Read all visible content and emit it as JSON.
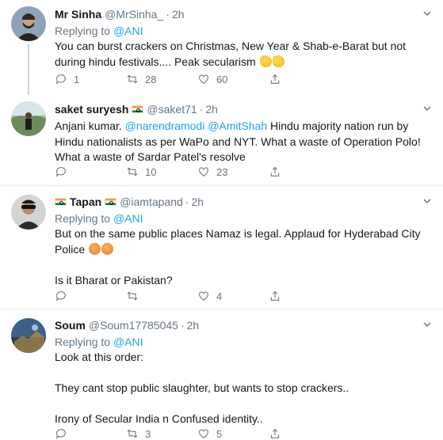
{
  "tweets": [
    {
      "name": "Mr Sinha",
      "handle": "@MrSinha_",
      "time": "2h",
      "flag": false,
      "replying_label": "Replying to ",
      "replying_to": "@ANI",
      "lines": [
        "You can burst crackers on Christmas, New Year & Shab-e-Barat but not",
        "during hindu festivals.... Peak secularism"
      ],
      "replies": "1",
      "retweets": "28",
      "likes": "60",
      "avatar_colors": [
        "#7a8aa0",
        "#3b3a3a"
      ]
    },
    {
      "name": "saket suryesh",
      "handle": "@saket71",
      "time": "2h",
      "flag": true,
      "mention1": "@narendramodi",
      "mention2": "@AmitShah",
      "prefix": "Anjani kumar. ",
      "suffix": " Hindu majority nation run by",
      "lines": [
        "Hindu nationalists as per WaPo and NYT. What a waste of Operation Polo!",
        "What a waste of Sardar Patel's resolve"
      ],
      "replies": "",
      "retweets": "10",
      "likes": "23",
      "avatar_colors": [
        "#9bb59a",
        "#2e3b2b"
      ]
    },
    {
      "name": "Tapan",
      "handle": "@iamtapand",
      "time": "2h",
      "flag": true,
      "replying_label": "Replying to ",
      "replying_to": "@ANI",
      "lines": [
        "But on the same public places Namaz is legal. Applaud for Hyderabad City",
        "Police",
        "Is it Bharat or Pakistan?"
      ],
      "replies": "",
      "retweets": "",
      "likes": "4",
      "avatar_colors": [
        "#c9c9c9",
        "#2a2a2a"
      ]
    },
    {
      "name": "Soum",
      "handle": "@Soum17785045",
      "time": "2h",
      "flag": false,
      "replying_label": "Replying to ",
      "replying_to": "@ANI",
      "lines": [
        "Look at this order:",
        "They cant stop public slaughter, but wants to stop crackers..",
        "Irony of Secular India n Confused identity.."
      ],
      "replies": "",
      "retweets": "3",
      "likes": "5",
      "avatar_colors": [
        "#4a6f98",
        "#1f2d3f"
      ]
    }
  ]
}
